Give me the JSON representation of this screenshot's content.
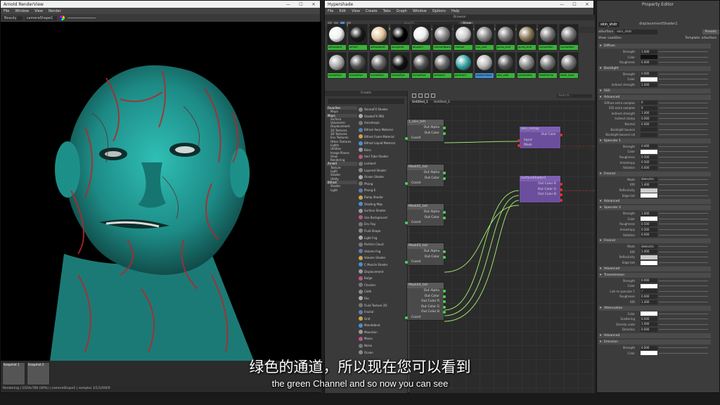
{
  "render_view": {
    "title": "Arnold RenderView",
    "menu": [
      "File",
      "Window",
      "View",
      "Render"
    ],
    "aov": "Beauty",
    "camera": "cameraShape1",
    "snapshots": [
      "Snapshot 1",
      "Snapshot 2"
    ],
    "status": "Rendering | 1024x768 (40%) | cameraShape1 | samples 1/1/1/0/0/0"
  },
  "hypershade": {
    "title": "Hypershade",
    "menu": [
      "File",
      "Edit",
      "View",
      "Create",
      "Tabs",
      "Graph",
      "Window",
      "Options",
      "Help"
    ],
    "browser_title": "Browser",
    "search_placeholder": "search...",
    "show_label": "Show",
    "browser_tabs": [
      "Materials",
      "Textures",
      "Utilities",
      "Rendering",
      "Lights",
      "Cameras",
      "Shading Groups",
      "Bake Sets",
      "Projects",
      "Asset Nodes"
    ],
    "swatches": [
      {
        "label": "aiStandard",
        "color": "#f2f2f2"
      },
      {
        "label": "aiFlat2",
        "color": "#1a1a1a"
      },
      {
        "label": "aiStandard1",
        "color": "#e5c9a1"
      },
      {
        "label": "aiLayered",
        "color": "#000000"
      },
      {
        "label": "aiLayer1",
        "color": "#f0f0f0"
      },
      {
        "label": "checkerBoard",
        "color": "#888888"
      },
      {
        "label": "checker",
        "color": "#cccccc"
      },
      {
        "label": "eye_shdr",
        "color": "#888888"
      },
      {
        "label": "gums_shdr",
        "color": "#777777"
      },
      {
        "label": "gums_shdr",
        "color": "#8a7a5a"
      },
      {
        "label": "humanSkin",
        "color": "#777777"
      },
      {
        "label": "humanSkin",
        "color": "#777777"
      },
      {
        "label": "humanEye",
        "color": "#aaaaaa"
      },
      {
        "label": "humanEye",
        "color": "#555555"
      },
      {
        "label": "humanEye",
        "color": "#666666"
      },
      {
        "label": "humanEye",
        "color": "#111111"
      },
      {
        "label": "humanEye",
        "color": "#555555"
      },
      {
        "label": "lambert1",
        "color": "#6a6a6a"
      },
      {
        "label": "particleCl",
        "color": "#3aa5a5"
      },
      {
        "label": "shaderGlow1",
        "color": "#bbbbbb"
      },
      {
        "label": "skin_shdr",
        "color": "#555555"
      },
      {
        "label": "surfaceSha",
        "color": "#888888"
      },
      {
        "label": "teethGrime",
        "color": "#777777"
      },
      {
        "label": "teeth_layer",
        "color": "#777777"
      }
    ],
    "create_title": "Create",
    "categories": [
      {
        "label": "Favorites",
        "group": true
      },
      {
        "label": "Maya",
        "group": false
      },
      {
        "label": "Maya",
        "group": true
      },
      {
        "label": "Surface",
        "group": false
      },
      {
        "label": "Volumetric",
        "group": false
      },
      {
        "label": "Displacement",
        "group": false
      },
      {
        "label": "2D Textures",
        "group": false
      },
      {
        "label": "3D Textures",
        "group": false
      },
      {
        "label": "Env Textures",
        "group": false
      },
      {
        "label": "Other Textures",
        "group": false
      },
      {
        "label": "Lights",
        "group": false
      },
      {
        "label": "Utilities",
        "group": false
      },
      {
        "label": "Image Planes",
        "group": false
      },
      {
        "label": "Glow",
        "group": false
      },
      {
        "label": "Rendering",
        "group": false
      },
      {
        "label": "Arnold",
        "group": true
      },
      {
        "label": "Texture",
        "group": false
      },
      {
        "label": "Light",
        "group": false
      },
      {
        "label": "Shader",
        "group": false
      },
      {
        "label": "Utility",
        "group": false
      },
      {
        "label": "Bifrost",
        "group": true
      },
      {
        "label": "Shader",
        "group": false
      },
      {
        "label": "Light",
        "group": false
      }
    ],
    "create_nodes": [
      "StereoFX Shader",
      "ShaderFX PBS",
      "Anisotropic",
      "Bifrost Aero Material",
      "Bifrost Foam Material",
      "Bifrost Liquid Material",
      "Blinn",
      "Hair Tube Shader",
      "Lambert",
      "Layered Shader",
      "Ocean Shader",
      "Phong",
      "Phong E",
      "Ramp Shader",
      "Shading Map",
      "Surface Shader",
      "Use Background",
      "Env Fog",
      "Fluid Shape",
      "Light Fog",
      "Particle Cloud",
      "Volume Fog",
      "Volume Shader",
      "C Muscle Shader",
      "Displacement",
      "Bulge",
      "Checker",
      "Cloth",
      "File",
      "Fluid Texture 2D",
      "Fractal",
      "Grid",
      "Mandelbrot",
      "Mountain",
      "Movie",
      "Noise",
      "Ocean"
    ],
    "graph_tabs": [
      "Untitled_1",
      "Untitled_2"
    ],
    "graph_search_placeholder": "Search...",
    "nodes": [
      {
        "title": "1_skin_txtr",
        "rows": [
          "Out Alpha",
          "Out Color"
        ],
        "inrows": [
          "Coord"
        ]
      },
      {
        "title": "Mask01_txtr",
        "rows": [
          "Out Alpha",
          "Out Color"
        ],
        "inrows": [
          "Coord"
        ]
      },
      {
        "title": "Mask02_txtr",
        "rows": [
          "Out Alpha",
          "Out Color"
        ],
        "inrows": [
          "Coord"
        ]
      },
      {
        "title": "Mask03_txtr",
        "rows": [
          "Out Alpha",
          "Out Color"
        ],
        "inrows": [
          "Coord"
        ]
      },
      {
        "title": "Mask04_txtr",
        "rows": [
          "Out Alpha",
          "Out Color",
          "Out Color R",
          "Out Color G",
          "Out Color B"
        ],
        "inrows": [
          "Coord"
        ]
      },
      {
        "title": "skin_remap",
        "rows": [
          "Out Color"
        ],
        "inrows": [
          "Input",
          "Mask"
        ]
      },
      {
        "title": "surfaceShader1",
        "rows": [
          "Out Color R",
          "Out Color G",
          "Out Color B"
        ],
        "inrows": []
      }
    ]
  },
  "property_editor": {
    "title": "Property Editor",
    "tab1": "skin_shdr",
    "tab2": "displacementShader1",
    "surface_label": "aiSurface",
    "surface_value": "skin_shdr",
    "presets": "Presets",
    "view": "View: LookDev",
    "template": "Template: aiSurface",
    "sections": [
      {
        "name": "Diffuse",
        "rows": [
          {
            "l": "Strength",
            "v": "1.000"
          },
          {
            "l": "Color",
            "c": "#111111"
          },
          {
            "l": "Roughness",
            "v": "0.000"
          }
        ]
      },
      {
        "name": "Backlight",
        "rows": [
          {
            "l": "Strength",
            "v": "0.000"
          },
          {
            "l": "Color",
            "c": "#ffffff"
          },
          {
            "l": "Indirect strength",
            "v": "1.000"
          }
        ]
      },
      {
        "name": "SSS",
        "rows": []
      },
      {
        "name": "Advanced",
        "rows": [
          {
            "l": "Diffuse extra samples",
            "v": "0"
          },
          {
            "l": "SSS extra samples",
            "v": "0"
          },
          {
            "l": "Indirect strength",
            "v": "1.000"
          },
          {
            "l": "Indirect clamp",
            "v": "0.000"
          },
          {
            "l": "Normal",
            "v": "0.000"
          },
          {
            "l": "Backlight bounce",
            "v": ""
          },
          {
            "l": "Backlight bounce col",
            "v": ""
          }
        ]
      },
      {
        "name": "Specular 1",
        "rows": [
          {
            "l": "Strength",
            "v": "0.000"
          },
          {
            "l": "Color",
            "c": "#ffffff"
          },
          {
            "l": "Roughness",
            "v": "0.500"
          },
          {
            "l": "Anisotropy",
            "v": "0.500"
          },
          {
            "l": "Rotation",
            "v": "0.000"
          }
        ]
      },
      {
        "name": "Fresnel",
        "rows": [
          {
            "l": "Mode",
            "v": "dielectric"
          },
          {
            "l": "IOR",
            "v": "1.400"
          },
          {
            "l": "Reflectivity",
            "c": "#cccccc"
          },
          {
            "l": "Edge tint",
            "c": "#ffffff"
          }
        ]
      },
      {
        "name": "Advanced",
        "rows": []
      },
      {
        "name": "Specular 2",
        "rows": [
          {
            "l": "Strength",
            "v": "1.000"
          },
          {
            "l": "Color",
            "c": "#ffffff"
          },
          {
            "l": "Roughness",
            "v": "0.500"
          },
          {
            "l": "Anisotropy",
            "v": "0.500"
          },
          {
            "l": "Rotation",
            "v": "0.000"
          }
        ]
      },
      {
        "name": "Fresnel",
        "rows": [
          {
            "l": "Mode",
            "v": "dielectric"
          },
          {
            "l": "IOR",
            "v": "1.400"
          },
          {
            "l": "Reflectivity",
            "c": "#cccccc"
          },
          {
            "l": "Edge tint",
            "c": "#ffffff"
          }
        ]
      },
      {
        "name": "Advanced",
        "rows": []
      },
      {
        "name": "Transmission",
        "rows": [
          {
            "l": "Strength",
            "v": "0.000"
          },
          {
            "l": "Color",
            "c": "#ffffff"
          },
          {
            "l": "Link to specular 1",
            "v": "✓"
          },
          {
            "l": "Roughness",
            "v": "0.000"
          },
          {
            "l": "IOR",
            "v": "1.400"
          }
        ]
      },
      {
        "name": "Attenuation",
        "rows": [
          {
            "l": "Color",
            "c": "#ffffff"
          },
          {
            "l": "Scattering",
            "v": "0.000"
          },
          {
            "l": "Density scale",
            "v": "1.000"
          },
          {
            "l": "Direction",
            "v": "0.000"
          }
        ]
      },
      {
        "name": "Advanced",
        "rows": []
      },
      {
        "name": "Emission",
        "rows": [
          {
            "l": "Strength",
            "v": "0.000"
          },
          {
            "l": "Color",
            "c": "#ffffff"
          }
        ]
      }
    ]
  },
  "subtitles": {
    "cn": "绿色的通道，所以现在您可以看到",
    "en": "the green Channel and so now you can see"
  },
  "colors": {
    "accent_blue": "#3d8fd0",
    "swatch_green": "#38b238",
    "connection_green": "#9be36b",
    "surface_purple": "#7d5fb3",
    "face_cyan": "#2aa7a0",
    "face_red": "#b3282c"
  }
}
